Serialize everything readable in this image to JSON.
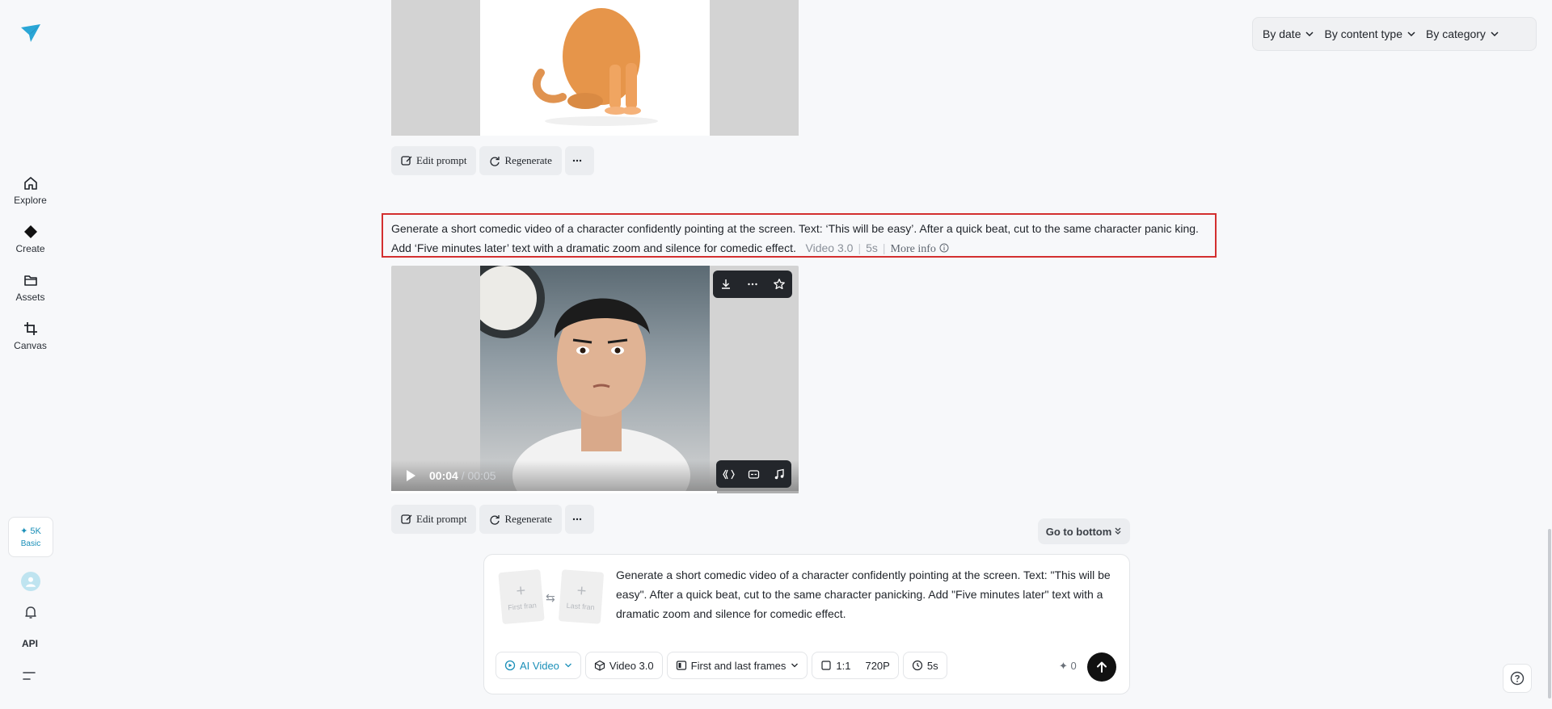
{
  "sidebar": {
    "items": [
      {
        "label": "Explore",
        "icon": "home-icon"
      },
      {
        "label": "Create",
        "icon": "diamond-icon"
      },
      {
        "label": "Assets",
        "icon": "folder-icon"
      },
      {
        "label": "Canvas",
        "icon": "crop-icon"
      }
    ],
    "credits_amount": "✦ 5K",
    "plan": "Basic",
    "api_label": "API"
  },
  "filters": {
    "date": "By date",
    "content_type": "By content type",
    "category": "By category"
  },
  "actions": {
    "edit_prompt": "Edit prompt",
    "regenerate": "Regenerate"
  },
  "generation": {
    "prompt": "Generate a short comedic video of a character confidently pointing at the screen. Text: ‘This will be easy’. After a quick beat, cut to the same character panic king. Add ‘Five minutes later’ text with a dramatic zoom and silence for comedic effect.",
    "model": "Video 3.0",
    "duration": "5s",
    "more_info": "More info"
  },
  "video": {
    "current_time": "00:04",
    "total_time": "/ 00:05",
    "progress": 0.8
  },
  "go_to_bottom": "Go to bottom",
  "composer": {
    "first_frame": "First fran",
    "last_frame": "Last fran",
    "swap": "⇆",
    "text": "Generate a short comedic video of a character confidently pointing at the screen. Text: \"This will be easy\". After a quick beat, cut to the same character panicking. Add \"Five minutes later\" text with a dramatic zoom and silence for comedic effect.",
    "mode": "AI Video",
    "model": "Video 3.0",
    "frames_mode": "First and last frames",
    "ratio": "1:1",
    "resolution": "720P",
    "duration": "5s",
    "cost": "✦ 0"
  },
  "colors": {
    "accent": "#1a8fb8",
    "highlight_border": "#d32f2f"
  }
}
